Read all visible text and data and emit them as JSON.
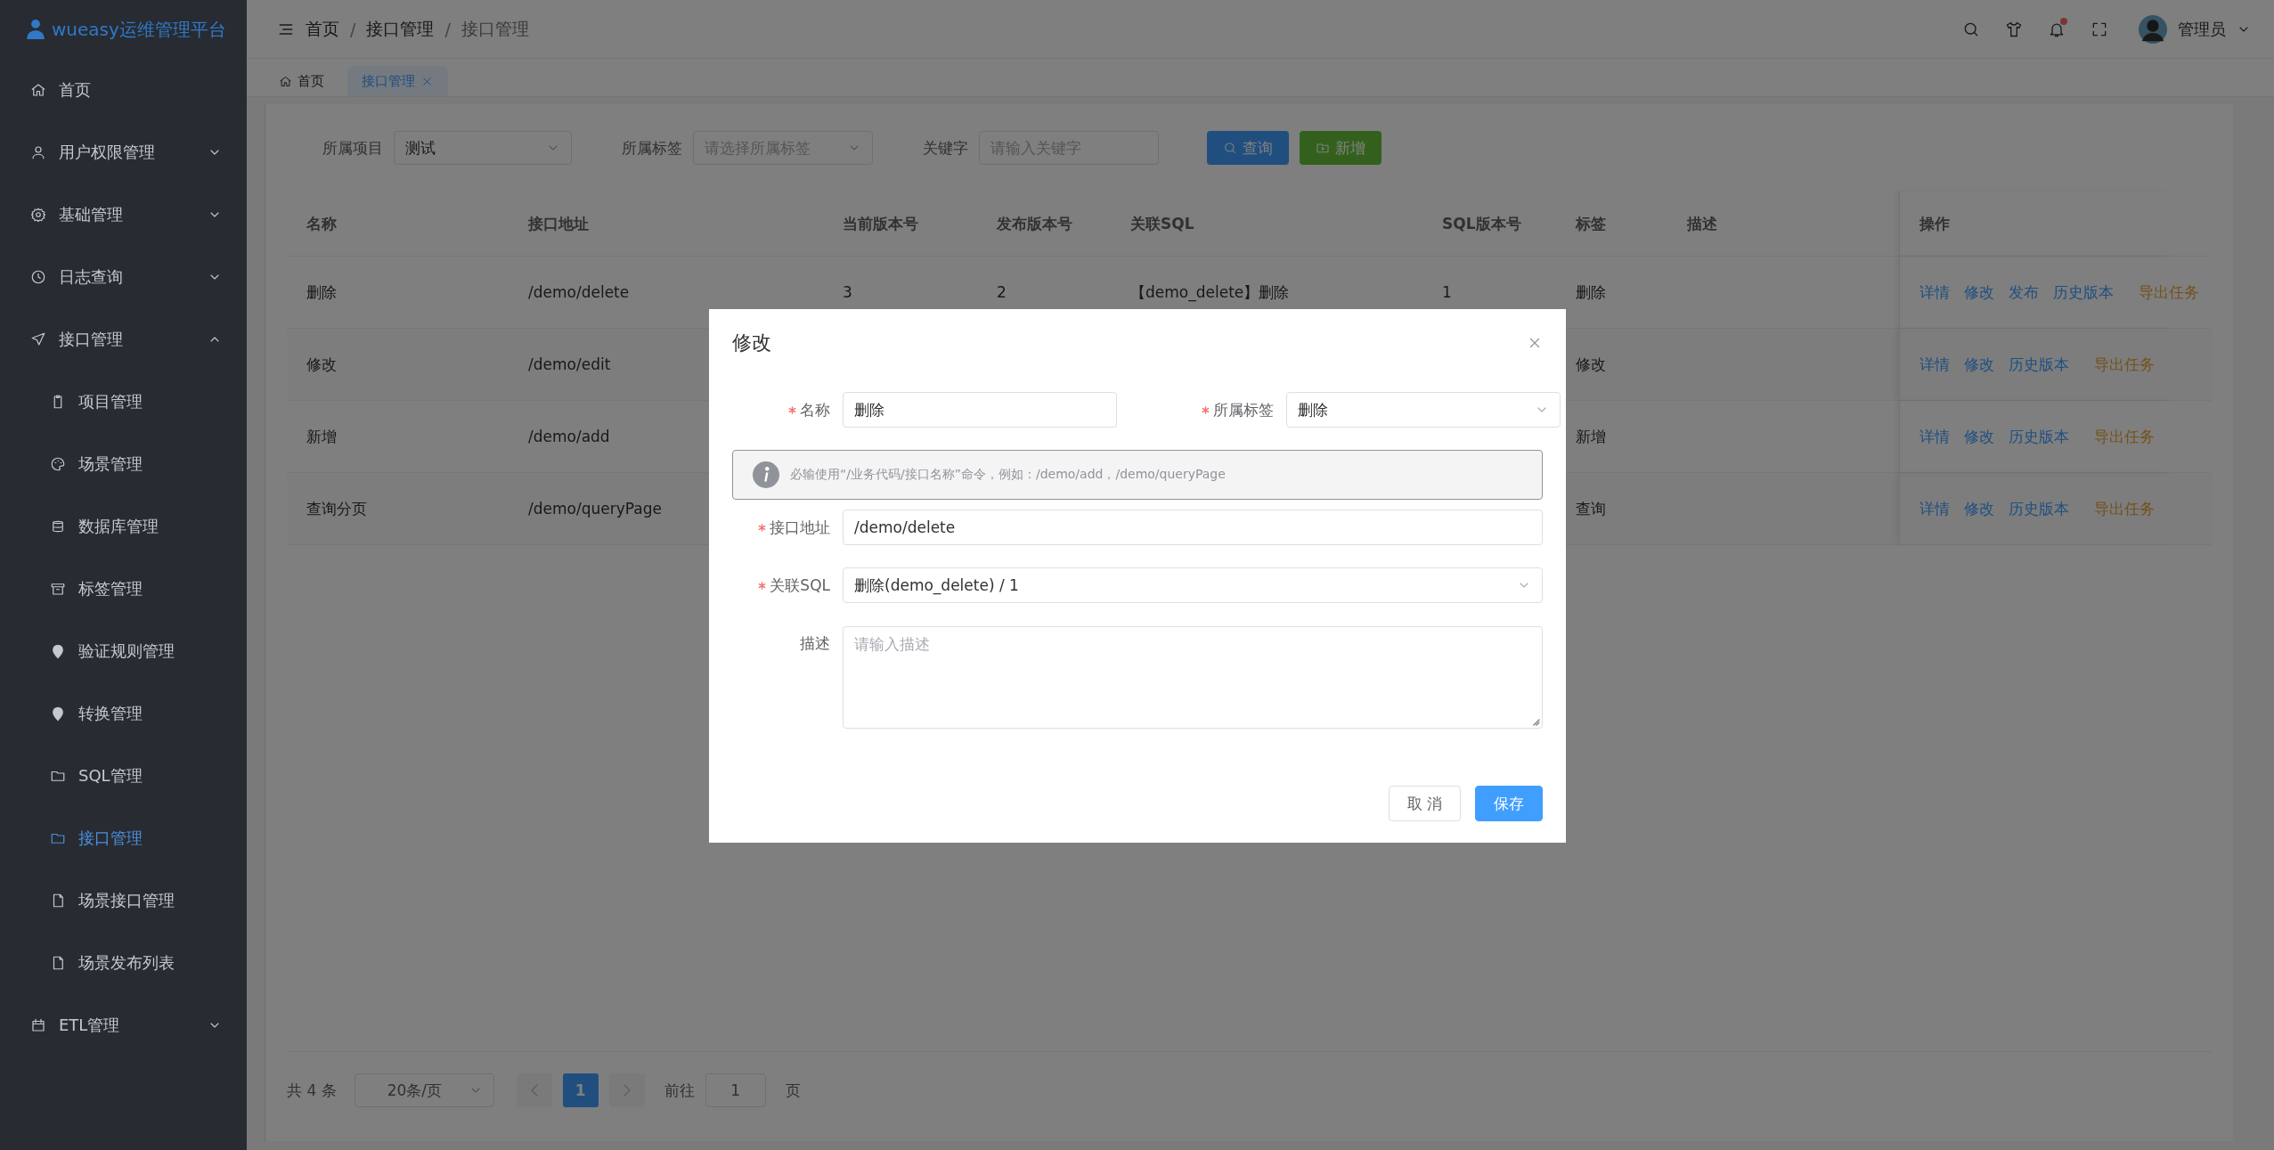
{
  "app": {
    "title": "wueasy运维管理平台"
  },
  "sidebar": {
    "items": [
      {
        "label": "首页",
        "selected": false
      },
      {
        "label": "用户权限管理",
        "selected": false,
        "expanded": false
      },
      {
        "label": "基础管理",
        "selected": false,
        "expanded": false
      },
      {
        "label": "日志查询",
        "selected": false,
        "expanded": false
      },
      {
        "label": "接口管理",
        "selected": false,
        "expanded": true,
        "children": [
          {
            "label": "项目管理",
            "selected": false
          },
          {
            "label": "场景管理",
            "selected": false
          },
          {
            "label": "数据库管理",
            "selected": false
          },
          {
            "label": "标签管理",
            "selected": false
          },
          {
            "label": "验证规则管理",
            "selected": false
          },
          {
            "label": "转换管理",
            "selected": false
          },
          {
            "label": "SQL管理",
            "selected": false
          },
          {
            "label": "接口管理",
            "selected": true
          },
          {
            "label": "场景接口管理",
            "selected": false
          },
          {
            "label": "场景发布列表",
            "selected": false
          }
        ]
      },
      {
        "label": "ETL管理",
        "selected": false,
        "expanded": false
      }
    ]
  },
  "header": {
    "breadcrumb": [
      "首页",
      "接口管理",
      "接口管理"
    ],
    "separator": "/",
    "user": "管理员",
    "notification": true
  },
  "tabs": [
    {
      "label": "首页",
      "selected": false,
      "closable": false
    },
    {
      "label": "接口管理",
      "selected": true,
      "closable": true
    }
  ],
  "filters": [
    {
      "kind": "select",
      "label": "所属项目",
      "value": "测试"
    },
    {
      "kind": "select",
      "label": "所属标签",
      "placeholder": "请选择所属标签"
    },
    {
      "kind": "input",
      "label": "关键字",
      "placeholder": "请输入关键字"
    }
  ],
  "toolbar": [
    {
      "kind": "primary",
      "label": "查询"
    },
    {
      "kind": "success",
      "label": "新增"
    }
  ],
  "table": {
    "columns": [
      "名称",
      "接口地址",
      "当前版本号",
      "发布版本号",
      "关联SQL",
      "SQL版本号",
      "标签",
      "描述",
      "操作"
    ],
    "rows": [
      {
        "name": "删除",
        "path": "/demo/delete",
        "current_version": "3",
        "publish_version": "2",
        "sql": "【demo_delete】删除",
        "sql_version": "1",
        "tag": "删除",
        "actions": [
          {
            "kind": "link",
            "label": "详情"
          },
          {
            "kind": "link",
            "label": "修改"
          },
          {
            "kind": "link",
            "label": "发布"
          },
          {
            "kind": "link",
            "label": "历史版本"
          },
          {
            "kind": "warning",
            "label": "导出任务"
          }
        ]
      },
      {
        "name": "修改",
        "path": "/demo/edit",
        "tag": "修改",
        "actions": [
          {
            "kind": "link",
            "label": "详情"
          },
          {
            "kind": "link",
            "label": "修改"
          },
          {
            "kind": "link",
            "label": "历史版本"
          },
          {
            "kind": "warning",
            "label": "导出任务"
          }
        ]
      },
      {
        "name": "新增",
        "path": "/demo/add",
        "tag": "新增",
        "actions": [
          {
            "kind": "link",
            "label": "详情"
          },
          {
            "kind": "link",
            "label": "修改"
          },
          {
            "kind": "link",
            "label": "历史版本"
          },
          {
            "kind": "warning",
            "label": "导出任务"
          }
        ]
      },
      {
        "name": "查询分页",
        "path": "/demo/queryPage",
        "tag": "查询",
        "actions": [
          {
            "kind": "link",
            "label": "详情"
          },
          {
            "kind": "link",
            "label": "修改"
          },
          {
            "kind": "link",
            "label": "历史版本"
          },
          {
            "kind": "warning",
            "label": "导出任务"
          }
        ]
      }
    ]
  },
  "pagination": {
    "total": "共 4 条",
    "page_size": "20条/页",
    "pages": [
      {
        "label": "1",
        "selected": true
      }
    ],
    "goto_label": "前往",
    "goto_value": "1",
    "goto_suffix": "页"
  },
  "dialog": {
    "title": "修改",
    "top_fields": [
      {
        "kind": "input",
        "required": true,
        "label": "名称",
        "value": "删除"
      },
      {
        "kind": "select",
        "required": true,
        "label": "所属标签",
        "value": "删除"
      }
    ],
    "notice": "必输使用“/业务代码/接口名称”命令，例如：/demo/add，/demo/queryPage",
    "fields": [
      {
        "kind": "input",
        "required": true,
        "label": "接口地址",
        "value": "/demo/delete"
      },
      {
        "kind": "select",
        "required": true,
        "label": "关联SQL",
        "value": "删除(demo_delete) / 1"
      },
      {
        "kind": "textarea",
        "required": false,
        "label": "描述",
        "placeholder": "请输入描述"
      }
    ],
    "buttons": [
      {
        "kind": "default",
        "label": "取 消"
      },
      {
        "kind": "primary",
        "label": "保存"
      }
    ]
  }
}
